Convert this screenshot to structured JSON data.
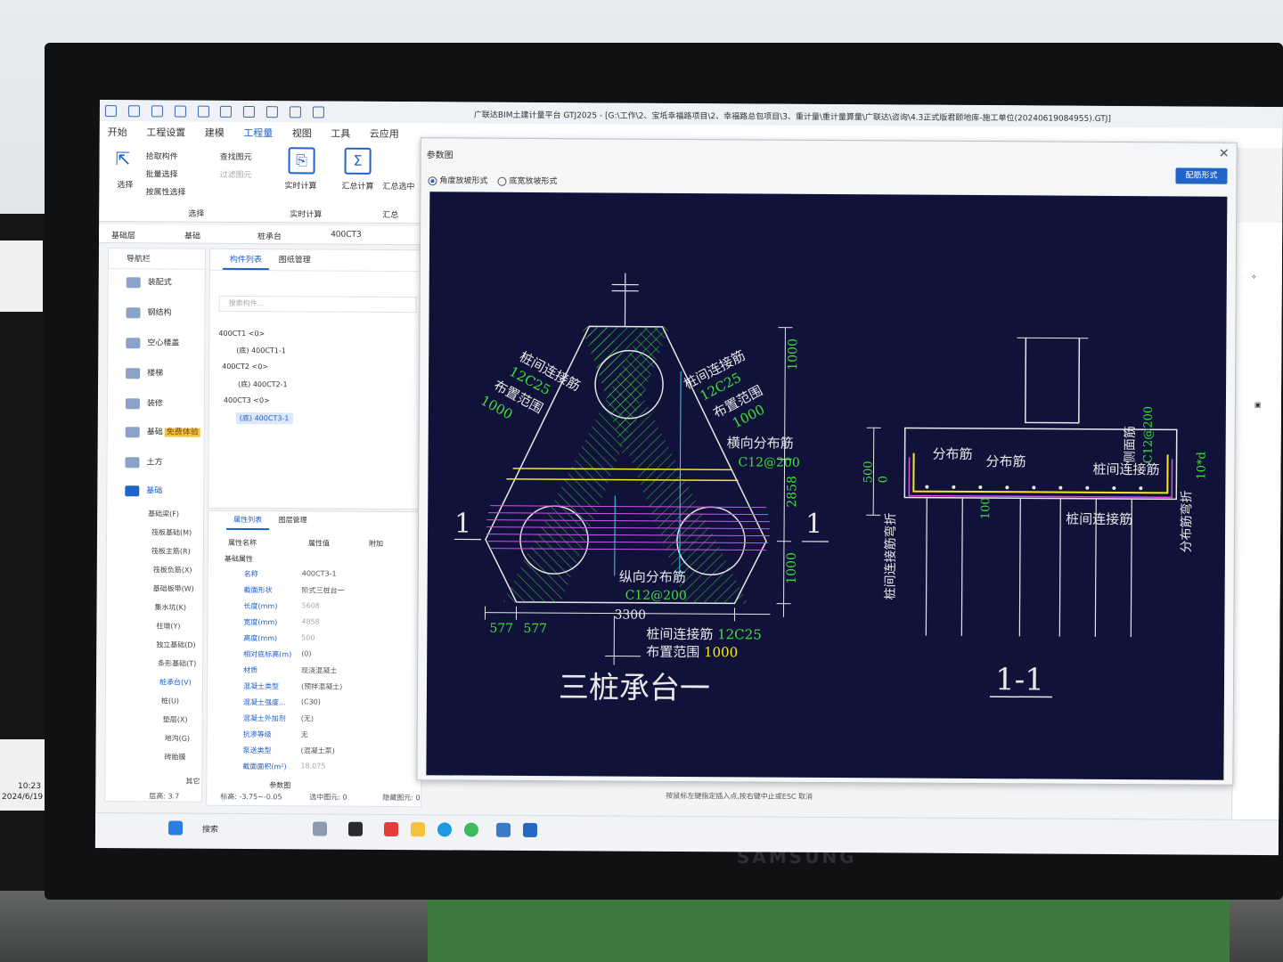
{
  "titlebar": {
    "title": "广联达BIM土建计量平台 GTJ2025 - [G:\\工作\\2、宝坻幸福路项目\\2、幸福路总包项目\\3、重计量\\重计量算量\\广联达\\咨询\\4.3正式版君颐地库-施工单位(20240619084955).GTJ]"
  },
  "menu": {
    "items": [
      "开始",
      "工程设置",
      "建模",
      "工程量",
      "视图",
      "工具",
      "云应用"
    ],
    "active": "工程量"
  },
  "ribbon": {
    "select_label": "选择",
    "pick": "拾取构件",
    "batch": "批量选择",
    "by_attr": "按属性选择",
    "find": "查找图元",
    "filter": "过滤图元",
    "group_select": "选择",
    "realtime": "实时计算",
    "group_realtime": "实时计算",
    "sum_calc": "汇总计算",
    "sum_sel": "汇总选中",
    "group_sum": "汇总"
  },
  "selectors": [
    "基础层",
    "基础",
    "桩承台",
    "400CT3"
  ],
  "nav": {
    "title": "导航栏",
    "items": [
      "装配式",
      "钢结构",
      "空心楼盖",
      "楼梯",
      "装修",
      "基础",
      "土方",
      "基础"
    ],
    "badge": "免费体验",
    "subitems": [
      "基础梁(F)",
      "筏板基础(M)",
      "筏板主筋(R)",
      "筏板负筋(X)",
      "基础板带(W)",
      "集水坑(K)",
      "柱墩(Y)",
      "独立基础(D)",
      "条形基础(T)",
      "桩承台(V)",
      "桩(U)",
      "垫层(X)",
      "地沟(G)",
      "砖胎膜",
      "其它"
    ],
    "selected_sub": "桩承台(V)"
  },
  "comp_panel": {
    "tabs": [
      "构件列表",
      "图纸管理"
    ],
    "search_placeholder": "搜索构件...",
    "tree": [
      "400CT1 <0>",
      "(底) 400CT1-1",
      "400CT2 <0>",
      "(底) 400CT2-1",
      "400CT3 <0>",
      "(底) 400CT3-1"
    ]
  },
  "props_panel": {
    "tabs": [
      "属性列表",
      "图层管理"
    ],
    "headers": [
      "属性名称",
      "属性值",
      "附加"
    ],
    "group": "基础属性",
    "rows": [
      {
        "name": "名称",
        "value": "400CT3-1"
      },
      {
        "name": "截面形状",
        "value": "阶式三桩台一"
      },
      {
        "name": "长度(mm)",
        "value": "5608"
      },
      {
        "name": "宽度(mm)",
        "value": "4858"
      },
      {
        "name": "高度(mm)",
        "value": "500"
      },
      {
        "name": "相对底标高(m)",
        "value": "(0)"
      },
      {
        "name": "材质",
        "value": "现浇混凝土"
      },
      {
        "name": "混凝土类型",
        "value": "(预拌混凝土)"
      },
      {
        "name": "混凝土强度...",
        "value": "(C30)"
      },
      {
        "name": "混凝土外加剂",
        "value": "(无)"
      },
      {
        "name": "抗渗等级",
        "value": "无"
      },
      {
        "name": "泵送类型",
        "value": "(混凝土泵)"
      },
      {
        "name": "截面面积(m²)",
        "value": "18.075"
      }
    ],
    "footer": "参数图"
  },
  "status": {
    "floor": "层高: 3.7",
    "elev": "标高: -3.75~-0.05",
    "sel": "选中图元: 0",
    "hidden": "隐藏图元: 0",
    "hint": "按鼠标左键指定插入点,按右键中止或ESC 取消"
  },
  "taskbar": {
    "search": "搜索"
  },
  "left_monitor": {
    "time": "10:23",
    "date": "2024/6/19"
  },
  "monitor_brand": "SAMSUNG",
  "dialog": {
    "title": "参数图",
    "radio1": "角度放坡形式",
    "radio2": "底宽放坡形式",
    "button": "配筋形式",
    "drawing": {
      "labels_left": [
        "桩间连接筋",
        "12C25",
        "布置范围",
        "1000"
      ],
      "labels_right": [
        "桩间连接筋",
        "12C25",
        "布置范围",
        "1000"
      ],
      "transverse": "横向分布筋",
      "transverse_spec": "C12@200",
      "longitudinal": "纵向分布筋",
      "longitudinal_spec": "C12@200",
      "dim_top": "1000",
      "dim_mid": "2858",
      "dim_bot": "1000",
      "dim_width": "3300",
      "dim_577a": "577",
      "dim_577b": "577",
      "bottom_note1": "桩间连接筋 ",
      "bottom_note1_spec": "12C25",
      "bottom_note2": "布置范围 ",
      "bottom_note2_val": "1000",
      "section_mark": "1",
      "title_plan": "三桩承台一",
      "title_section": "1-1",
      "sec_dist1": "分布筋",
      "sec_dist2": "分布筋",
      "sec_tie": "桩间连接筋",
      "sec_tie2": "桩间连接筋",
      "sec_side": "侧面筋",
      "sec_side_spec": "C12@200",
      "sec_500": "500",
      "sec_0": "0",
      "sec_100": "100",
      "sec_10d": "10*d",
      "sec_vert_left": "桩间连接筋弯折",
      "sec_vert_right": "分布筋弯折"
    }
  },
  "colors": {
    "cad_bg": "#11123a",
    "hatch": "#3fe03a",
    "white": "#e8e8e8",
    "yellow": "#f3ea1f",
    "magenta": "#d44ff0",
    "cyan": "#3fd0e6",
    "accent": "#1f64c8"
  }
}
